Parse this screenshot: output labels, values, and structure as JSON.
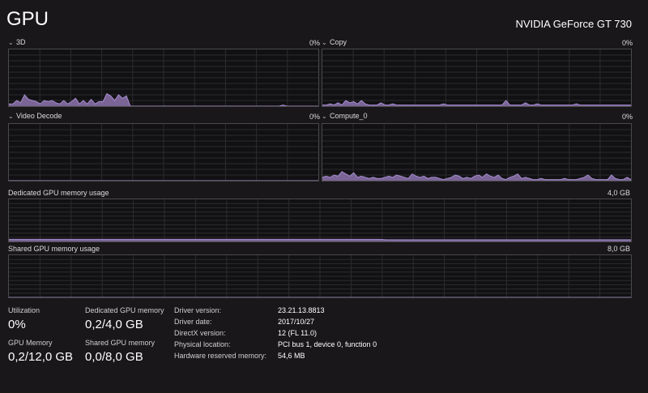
{
  "header": {
    "title": "GPU",
    "gpu_name": "NVIDIA GeForce GT 730"
  },
  "engines": [
    {
      "label": "3D",
      "value": "0%",
      "usage": [
        4,
        4,
        10,
        6,
        20,
        12,
        10,
        8,
        4,
        10,
        8,
        10,
        6,
        4,
        10,
        4,
        8,
        14,
        4,
        10,
        4,
        12,
        4,
        8,
        8,
        22,
        18,
        10,
        20,
        14,
        18,
        0,
        0,
        0,
        0,
        0,
        0,
        0,
        0,
        0,
        0,
        0,
        0,
        0,
        0,
        0,
        0,
        0,
        0,
        0,
        0,
        0,
        0,
        0,
        0,
        0,
        0,
        0,
        0,
        0,
        0,
        0,
        0,
        0,
        0,
        0,
        0,
        0,
        0,
        0,
        2,
        0,
        0,
        0,
        0,
        0,
        0,
        0,
        0,
        0
      ]
    },
    {
      "label": "Copy",
      "value": "0%",
      "usage": [
        2,
        2,
        4,
        2,
        6,
        2,
        10,
        6,
        8,
        4,
        10,
        4,
        2,
        2,
        2,
        6,
        2,
        2,
        4,
        2,
        2,
        2,
        2,
        2,
        2,
        2,
        2,
        2,
        2,
        2,
        2,
        4,
        2,
        2,
        2,
        2,
        2,
        2,
        2,
        2,
        2,
        2,
        2,
        2,
        2,
        2,
        2,
        10,
        2,
        2,
        2,
        2,
        6,
        2,
        2,
        4,
        2,
        2,
        2,
        2,
        2,
        2,
        2,
        2,
        2,
        4,
        2,
        2,
        2,
        2,
        2,
        2,
        2,
        2,
        2,
        2,
        2,
        2,
        2,
        2
      ]
    },
    {
      "label": "Video Decode",
      "value": "0%",
      "usage": [
        0,
        0,
        0,
        0,
        0,
        0,
        0,
        0,
        0,
        0,
        0,
        0,
        0,
        0,
        0,
        0,
        0,
        0,
        0,
        0,
        0,
        0,
        0,
        0,
        0,
        0,
        0,
        0,
        0,
        0,
        0,
        0,
        0,
        0,
        0,
        0,
        0,
        0,
        0,
        0,
        0,
        0,
        0,
        0,
        0,
        0,
        0,
        0,
        0,
        0,
        0,
        0,
        0,
        0,
        0,
        0,
        0,
        0,
        0,
        0,
        0,
        0,
        0,
        0,
        0,
        0,
        0,
        0,
        0,
        0,
        0,
        0,
        0,
        0,
        0,
        0,
        0,
        0,
        0,
        0
      ]
    },
    {
      "label": "Compute_0",
      "value": "0%",
      "usage": [
        6,
        8,
        6,
        10,
        8,
        16,
        12,
        8,
        14,
        6,
        8,
        6,
        4,
        6,
        4,
        4,
        6,
        8,
        6,
        10,
        8,
        6,
        4,
        12,
        8,
        6,
        8,
        4,
        6,
        6,
        4,
        2,
        4,
        6,
        10,
        8,
        4,
        6,
        4,
        8,
        10,
        6,
        12,
        8,
        6,
        10,
        4,
        2,
        6,
        8,
        12,
        4,
        6,
        4,
        2,
        2,
        4,
        2,
        2,
        2,
        2,
        2,
        4,
        2,
        2,
        2,
        4,
        6,
        10,
        4,
        2,
        2,
        2,
        2,
        10,
        4,
        2,
        2,
        6,
        2
      ]
    }
  ],
  "memory_graphs": [
    {
      "label": "Dedicated GPU memory usage",
      "max": "4,0 GB",
      "usage": [
        5,
        5,
        5,
        5,
        5,
        5,
        5,
        5,
        5,
        5,
        5,
        5,
        5,
        5,
        5,
        5,
        5,
        5,
        5,
        5,
        5,
        5,
        5,
        5,
        5,
        5,
        5,
        5,
        5,
        5,
        5,
        5,
        5,
        5,
        5,
        5,
        5,
        5,
        5,
        5,
        5,
        5,
        5,
        5,
        5,
        5,
        5,
        5,
        4,
        4,
        4,
        4,
        4,
        4,
        4,
        4,
        4,
        4,
        4,
        4,
        4,
        4,
        4,
        4,
        4,
        4,
        4,
        4,
        4,
        4,
        4,
        4,
        4,
        4,
        4,
        4,
        4,
        4,
        4,
        4
      ]
    },
    {
      "label": "Shared GPU memory usage",
      "max": "8,0 GB",
      "usage": [
        0,
        0,
        0,
        0,
        0,
        0,
        0,
        0,
        0,
        0,
        0,
        0,
        0,
        0,
        0,
        0,
        0,
        0,
        0,
        0,
        0,
        0,
        0,
        0,
        0,
        0,
        0,
        0,
        0,
        0,
        0,
        0,
        0,
        0,
        0,
        0,
        0,
        0,
        0,
        0,
        0,
        0,
        0,
        0,
        0,
        0,
        0,
        0,
        0,
        0,
        0,
        0,
        0,
        0,
        0,
        0,
        0,
        0,
        0,
        0,
        0,
        0,
        0,
        0,
        0,
        0,
        0,
        0,
        0,
        0,
        0,
        0,
        0,
        0,
        0,
        0,
        0,
        0,
        0,
        0
      ]
    }
  ],
  "stats": {
    "utilization_label": "Utilization",
    "utilization_value": "0%",
    "dedicated_label": "Dedicated GPU memory",
    "dedicated_value": "0,2/4,0 GB",
    "gpu_memory_label": "GPU Memory",
    "gpu_memory_value": "0,2/12,0 GB",
    "shared_label": "Shared GPU memory",
    "shared_value": "0,0/8,0 GB"
  },
  "info": [
    {
      "key": "Driver version:",
      "value": "23.21.13.8813"
    },
    {
      "key": "Driver date:",
      "value": "2017/10/27"
    },
    {
      "key": "DirectX version:",
      "value": "12 (FL 11.0)"
    },
    {
      "key": "Physical location:",
      "value": "PCI bus 1, device 0, function 0"
    },
    {
      "key": "Hardware reserved memory:",
      "value": "54,6 MB"
    }
  ],
  "colors": {
    "accent_fill": "#7a6596",
    "accent_line": "#a58ccf",
    "grid": "#2c2b2d"
  }
}
